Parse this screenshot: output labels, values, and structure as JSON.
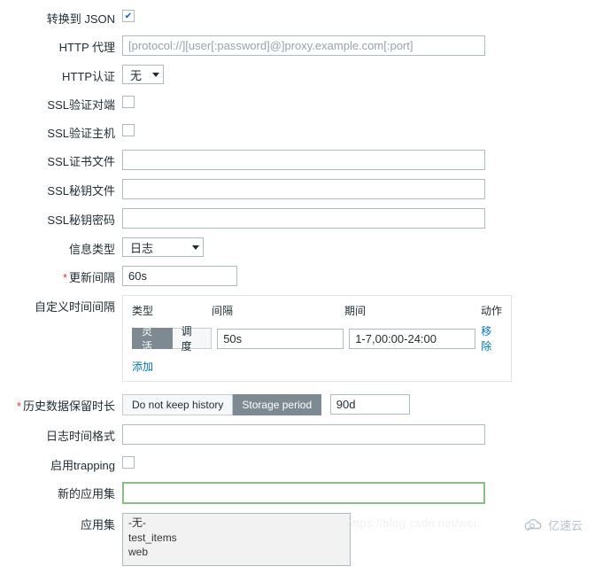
{
  "fields": {
    "convert_json": {
      "label": "转换到 JSON",
      "checked": true
    },
    "http_proxy": {
      "label": "HTTP 代理",
      "placeholder": "[protocol://][user[:password]@]proxy.example.com[:port]"
    },
    "http_auth": {
      "label": "HTTP认证",
      "value": "无"
    },
    "ssl_verify_peer": {
      "label": "SSL验证对端",
      "checked": false
    },
    "ssl_verify_host": {
      "label": "SSL验证主机",
      "checked": false
    },
    "ssl_cert_file": {
      "label": "SSL证书文件",
      "value": ""
    },
    "ssl_key_file": {
      "label": "SSL秘钥文件",
      "value": ""
    },
    "ssl_key_pass": {
      "label": "SSL秘钥密码",
      "value": ""
    },
    "info_type": {
      "label": "信息类型",
      "value": "日志"
    },
    "update_interval": {
      "label": "更新间隔",
      "value": "60s",
      "required": true
    },
    "custom_interval": {
      "label": "自定义时间间隔",
      "headers": {
        "type": "类型",
        "interval": "间隔",
        "period": "期间",
        "action": "动作"
      },
      "type_flexible": "灵活",
      "type_schedule": "调度",
      "interval_value": "50s",
      "period_value": "1-7,00:00-24:00",
      "remove": "移除",
      "add": "添加"
    },
    "history": {
      "label": "历史数据保留时长",
      "required": true,
      "do_not_keep": "Do not keep history",
      "storage_period": "Storage period",
      "value": "90d"
    },
    "log_time_format": {
      "label": "日志时间格式",
      "value": ""
    },
    "enable_trapping": {
      "label": "启用trapping",
      "checked": false
    },
    "new_appset": {
      "label": "新的应用集",
      "value": ""
    },
    "appset": {
      "label": "应用集",
      "options": [
        "-无-",
        "test_items",
        "web"
      ]
    }
  },
  "watermark": {
    "text": "亿速云",
    "faint": "https://blog.csdn.net/wei."
  }
}
